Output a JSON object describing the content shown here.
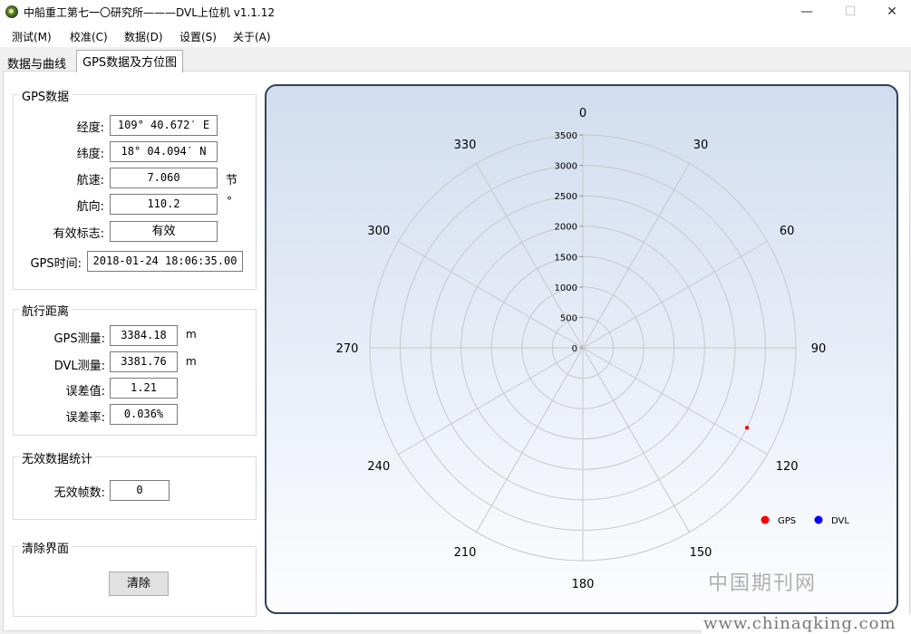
{
  "window": {
    "title": "中船重工第七一〇研究所———DVL上位机 v1.1.12",
    "controls": {
      "minimize": "—",
      "maximize": "☐",
      "close": "✕"
    }
  },
  "menu": [
    "测试(M)",
    "校准(C)",
    "数据(D)",
    "设置(S)",
    "关于(A)"
  ],
  "tabs": [
    {
      "label": "数据与曲线",
      "active": false
    },
    {
      "label": "GPS数据及方位图",
      "active": true
    }
  ],
  "gps": {
    "title": "GPS数据",
    "longitude_label": "经度:",
    "longitude": "109° 40.672′ E",
    "latitude_label": "纬度:",
    "latitude": "18° 04.094′ N",
    "speed_label": "航速:",
    "speed": "7.060",
    "speed_unit": "节",
    "heading_label": "航向:",
    "heading": "110.2",
    "heading_unit": "°",
    "valid_label": "有效标志:",
    "valid": "有效",
    "time_label": "GPS时间:",
    "time": "2018-01-24 18:06:35.00"
  },
  "distance": {
    "title": "航行距离",
    "gps_label": "GPS测量:",
    "gps": "3384.18",
    "gps_unit": "m",
    "dvl_label": "DVL测量:",
    "dvl": "3381.76",
    "dvl_unit": "m",
    "error_label": "误差值:",
    "error": "1.21",
    "rate_label": "误差率:",
    "rate": "0.036%"
  },
  "invalid": {
    "title": "无效数据统计",
    "frames_label": "无效帧数:",
    "frames": "0"
  },
  "clear": {
    "title": "清除界面",
    "button": "清除"
  },
  "chart_data": {
    "type": "polar",
    "angular_ticks": [
      "0",
      "30",
      "60",
      "90",
      "120",
      "150",
      "180",
      "210",
      "240",
      "270",
      "300",
      "330"
    ],
    "radial_ticks": [
      "0",
      "500",
      "1000",
      "1500",
      "2000",
      "2500",
      "3000",
      "3500"
    ],
    "rmax": 3500,
    "series": [
      {
        "name": "GPS",
        "color": "#ff0000",
        "points": [
          {
            "angle": 116,
            "r": 3000
          }
        ]
      },
      {
        "name": "DVL",
        "color": "#0000ff",
        "points": []
      }
    ],
    "legend_position": "bottom-right",
    "grid": true
  },
  "watermark": {
    "cn": "中国期刊网",
    "url": "www.chinaqking.com"
  }
}
